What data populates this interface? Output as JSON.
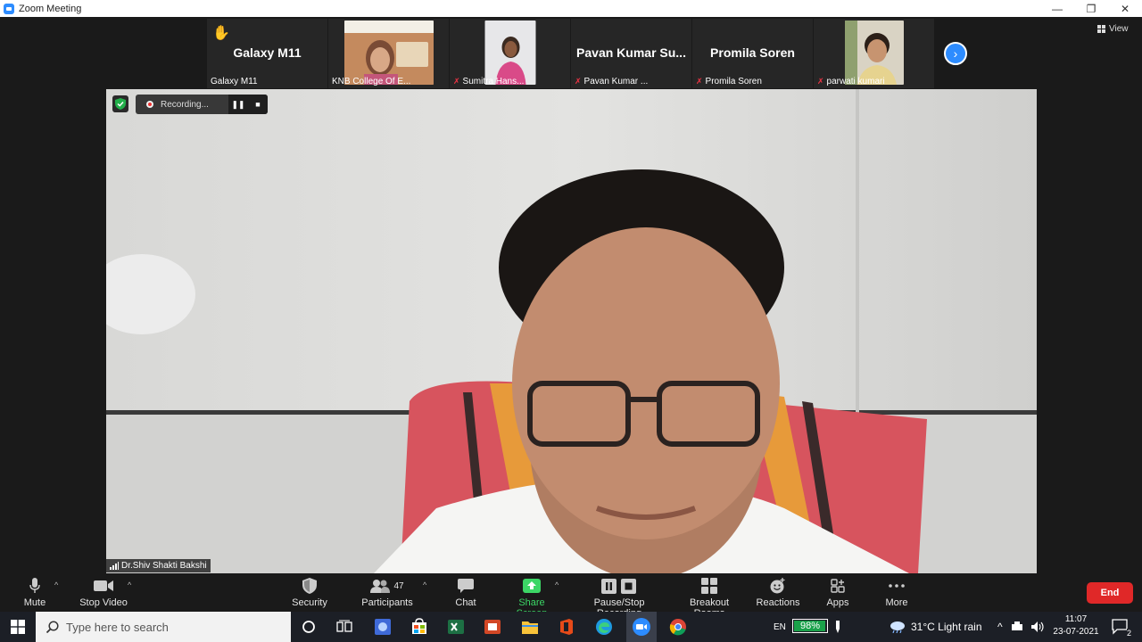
{
  "window": {
    "title": "Zoom Meeting",
    "minimize": "—",
    "restore": "❐",
    "close": "✕"
  },
  "view_button": "View",
  "gallery": [
    {
      "big_name": "Galaxy M11",
      "label": "Galaxy M11",
      "muted": false,
      "hand_raised": true,
      "has_video": false
    },
    {
      "big_name": "",
      "label": "KNB College Of E...",
      "muted": false,
      "has_video": true
    },
    {
      "big_name": "",
      "label": "Sumitra Hans...",
      "muted": true,
      "has_video": true
    },
    {
      "big_name": "Pavan Kumar Su...",
      "label": "Pavan Kumar ...",
      "muted": true,
      "has_video": false
    },
    {
      "big_name": "Promila Soren",
      "label": "Promila Soren",
      "muted": true,
      "has_video": false
    },
    {
      "big_name": "",
      "label": "parwati kumari",
      "muted": true,
      "has_video": true
    }
  ],
  "recording": {
    "status": "Recording..."
  },
  "active_speaker": "Dr.Shiv Shakti Bakshi",
  "toolbar": {
    "mute": "Mute",
    "stop_video": "Stop Video",
    "security": "Security",
    "participants": "Participants",
    "participant_count": "47",
    "chat": "Chat",
    "share_screen": "Share Screen",
    "recording": "Pause/Stop Recording",
    "breakout": "Breakout Rooms",
    "reactions": "Reactions",
    "apps": "Apps",
    "more": "More",
    "end": "End"
  },
  "taskbar": {
    "search_placeholder": "Type here to search",
    "language": "EN",
    "battery": "98%",
    "battery_level": 0.98,
    "weather": "31°C  Light rain",
    "time": "11:07",
    "date": "23-07-2021",
    "notifications": "2"
  },
  "colors": {
    "accent": "#2d8cff",
    "end": "#e02828",
    "share": "#3cd666",
    "muted": "#e34444"
  }
}
